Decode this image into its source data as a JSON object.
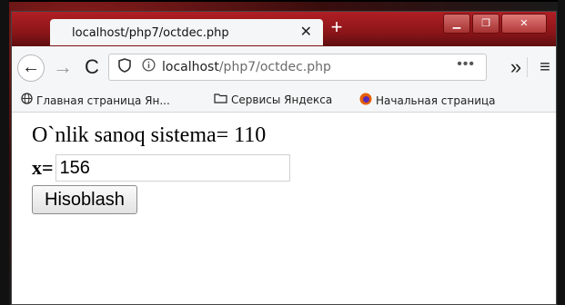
{
  "browser": {
    "tab": {
      "title": "localhost/php7/octdec.php",
      "close_glyph": "✕"
    },
    "new_tab_glyph": "+",
    "window_controls": {
      "minimize": "▁",
      "maximize": "❐",
      "close": "✕"
    },
    "nav": {
      "back_glyph": "←",
      "forward_glyph": "→",
      "reload_glyph": "C",
      "overflow_glyph": "»",
      "menu_glyph": "≡"
    },
    "url": {
      "host": "localhost",
      "path": "/php7/octdec.php",
      "page_actions_glyph": "•••"
    },
    "bookmarks": [
      {
        "icon": "globe-icon",
        "glyph": "🌐",
        "label": "Главная страница Ян..."
      },
      {
        "icon": "folder-icon",
        "glyph": "🗀",
        "label": "Сервисы Яндекса"
      },
      {
        "icon": "firefox-icon",
        "glyph": "●",
        "label": "Начальная страница"
      }
    ]
  },
  "page": {
    "result_text": "O`nlik sanoq sistema= 110",
    "input_label": "x=",
    "input_value": "156",
    "submit_label": "Hisoblash"
  },
  "colors": {
    "titlebar": "#b01f24",
    "firefox_icon": "#e66000"
  }
}
